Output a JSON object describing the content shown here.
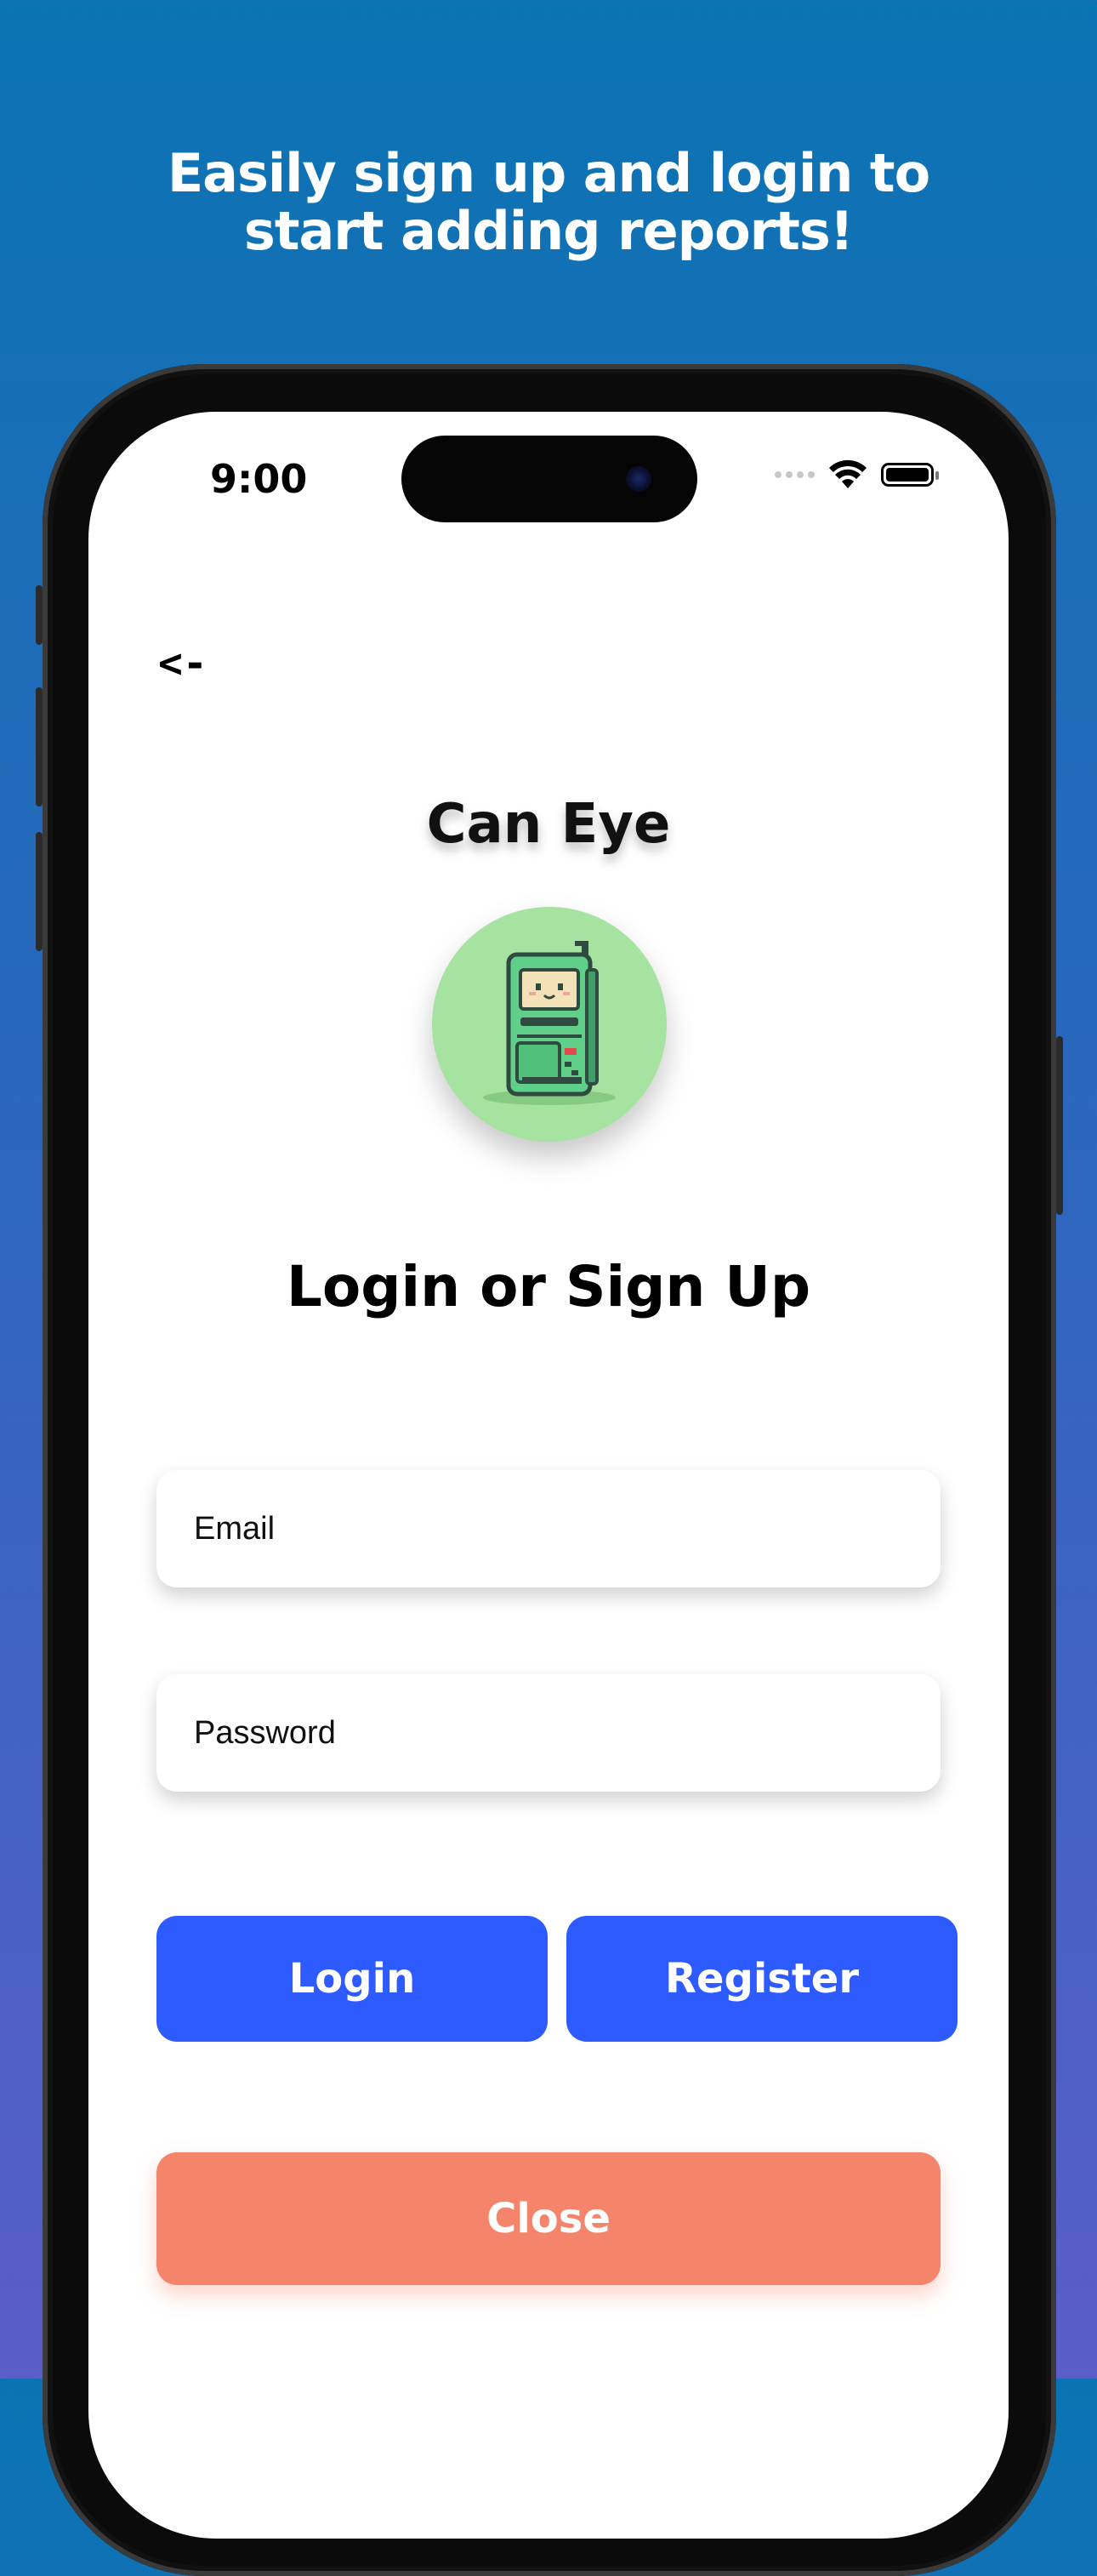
{
  "headline": {
    "line1": "Easily sign up and login to",
    "line2": "start adding reports!"
  },
  "status_bar": {
    "time": "9:00",
    "icons": [
      "cellular-signal-icon",
      "wifi-icon",
      "battery-icon"
    ]
  },
  "nav": {
    "back_label": "<-"
  },
  "app": {
    "title": "Can Eye",
    "avatar_icon": "robot-kiosk-icon",
    "avatar_bg": "#a6e3a1"
  },
  "auth": {
    "heading": "Login or Sign Up",
    "email_placeholder": "Email",
    "password_placeholder": "Password",
    "login_label": "Login",
    "register_label": "Register",
    "close_label": "Close"
  },
  "colors": {
    "primary_button": "#2d5bff",
    "close_button": "#f5856a",
    "background_top": "#0a74b3",
    "background_bottom": "#5a5ec6"
  }
}
